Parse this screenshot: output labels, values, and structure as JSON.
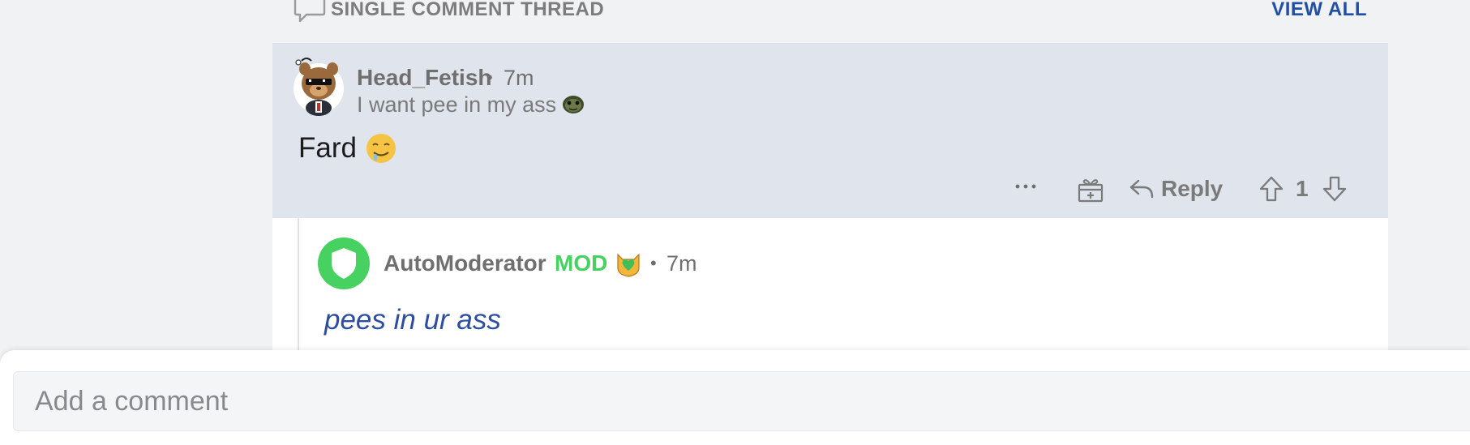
{
  "thread_header": {
    "label": "SINGLE COMMENT THREAD",
    "view_all": "VIEW ALL"
  },
  "comment": {
    "author": "Head_Fetish",
    "separator": "•",
    "time": "7m",
    "flair_text": "I want pee in my ass",
    "flair_emoji": "turtle-head-emoji",
    "body": "Fard",
    "body_emoji": "drooling-face-emoji",
    "actions": {
      "more": "more-options-icon",
      "award": "award-gift-icon",
      "reply_label": "Reply",
      "upvote": "upvote-arrow-icon",
      "score": "1",
      "downvote": "downvote-arrow-icon"
    },
    "highlight_color": "#dfe4ed"
  },
  "reply": {
    "author": "AutoModerator",
    "mod_badge": "MOD",
    "mod_emoji": "cat-shield-emoji",
    "separator": "•",
    "time": "7m",
    "body": "pees in ur ass",
    "mod_color": "#46d160",
    "body_color": "#2c4ea2"
  },
  "composer": {
    "placeholder": "Add a comment"
  },
  "colors": {
    "link_blue": "#1f4fa6",
    "meta_gray": "#6f6f6f"
  }
}
